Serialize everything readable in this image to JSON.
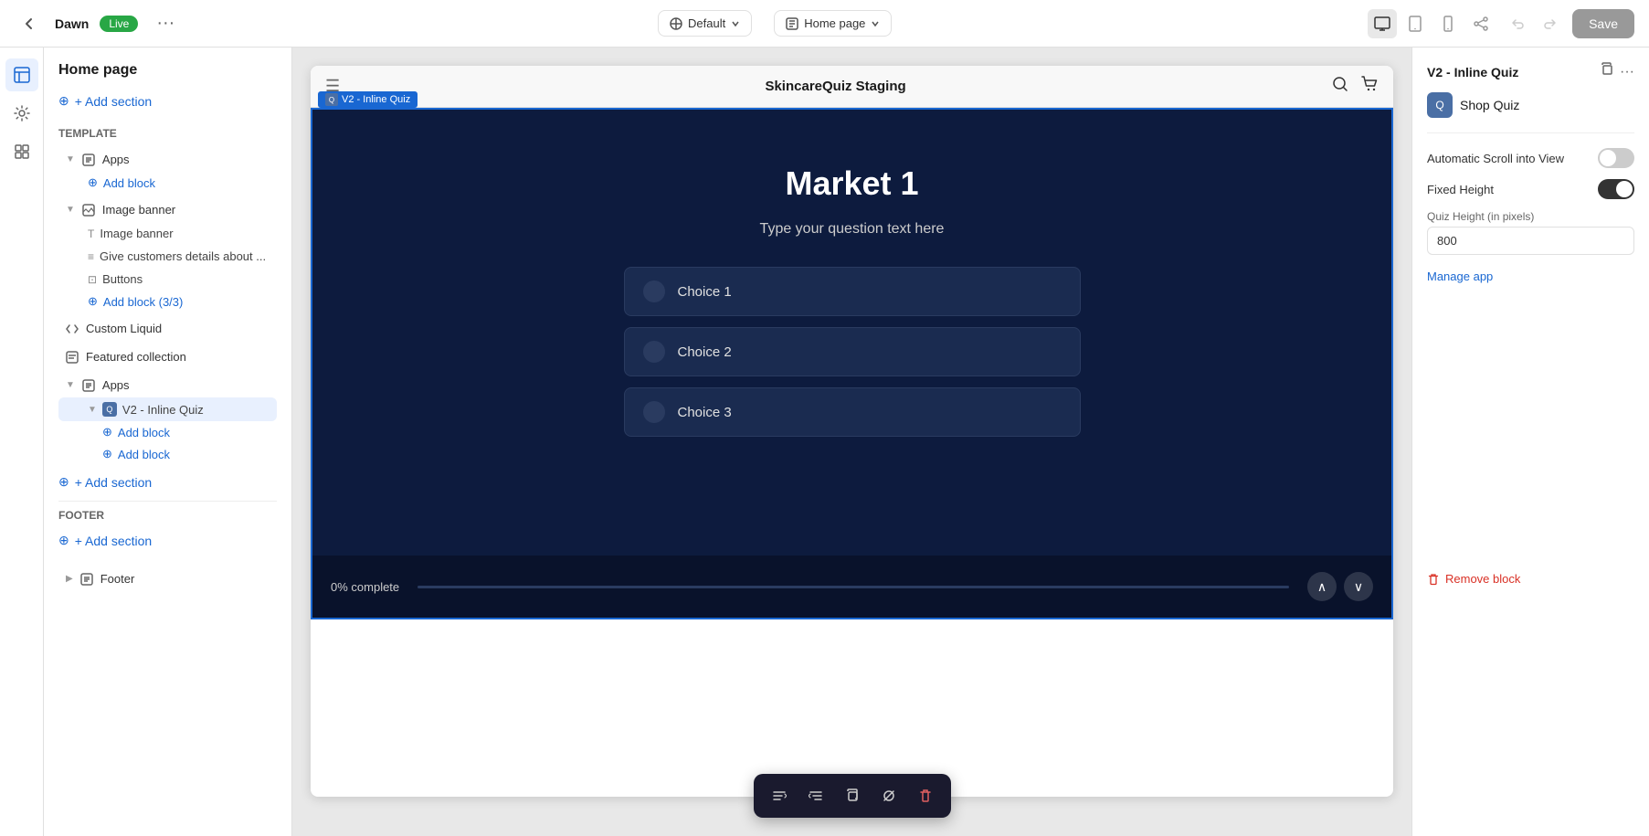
{
  "topbar": {
    "back_label": "←",
    "store_name": "Dawn",
    "live_label": "Live",
    "more_label": "···",
    "theme_label": "Default",
    "page_label": "Home page",
    "save_label": "Save"
  },
  "sidebar": {
    "page_title": "Home page",
    "add_section_label": "+ Add section",
    "template_label": "Template",
    "sections": [
      {
        "icon": "⊞",
        "label": "Apps",
        "collapsed": false
      },
      {
        "icon": "⊞",
        "label": "Image banner",
        "collapsed": false
      },
      {
        "icon": "</>",
        "label": "Custom Liquid"
      },
      {
        "icon": "⊞",
        "label": "Featured collection"
      },
      {
        "icon": "⊞",
        "label": "Apps",
        "collapsed": false,
        "active": true
      }
    ],
    "apps_children": [
      {
        "label": "Add block"
      },
      {
        "label": "Add block"
      }
    ],
    "image_banner_children": [
      {
        "icon": "T",
        "label": "Image banner"
      },
      {
        "icon": "≡",
        "label": "Give customers details about ..."
      },
      {
        "icon": "⊡",
        "label": "Buttons"
      }
    ],
    "v2_inline_quiz_label": "V2 - Inline Quiz",
    "add_block_1": "+ Add block",
    "add_block_2": "+ Add block",
    "add_block_3": "+ Add block (3/3)",
    "add_section_bottom_label": "+ Add section",
    "footer_label": "Footer",
    "footer_add_section": "+ Add section",
    "footer_item": "Footer"
  },
  "canvas": {
    "store_name": "SkincareQuiz Staging",
    "section_tag": "V2 - Inline Quiz",
    "quiz": {
      "title": "Market 1",
      "subtitle": "Type your question text here",
      "choices": [
        {
          "label": "Choice 1"
        },
        {
          "label": "Choice 2"
        },
        {
          "label": "Choice 3"
        }
      ],
      "progress_text": "0% complete"
    }
  },
  "right_panel": {
    "title": "V2 - Inline Quiz",
    "app_label": "Shop Quiz",
    "auto_scroll_label": "Automatic Scroll into View",
    "fixed_height_label": "Fixed Height",
    "quiz_height_label": "Quiz Height (in pixels)",
    "quiz_height_value": "800",
    "manage_app_label": "Manage app",
    "remove_block_label": "Remove block"
  },
  "toolbar": {
    "btn1": "↩",
    "btn2": "↪",
    "btn3": "⊕",
    "btn4": "⊘",
    "btn5": "🗑"
  }
}
